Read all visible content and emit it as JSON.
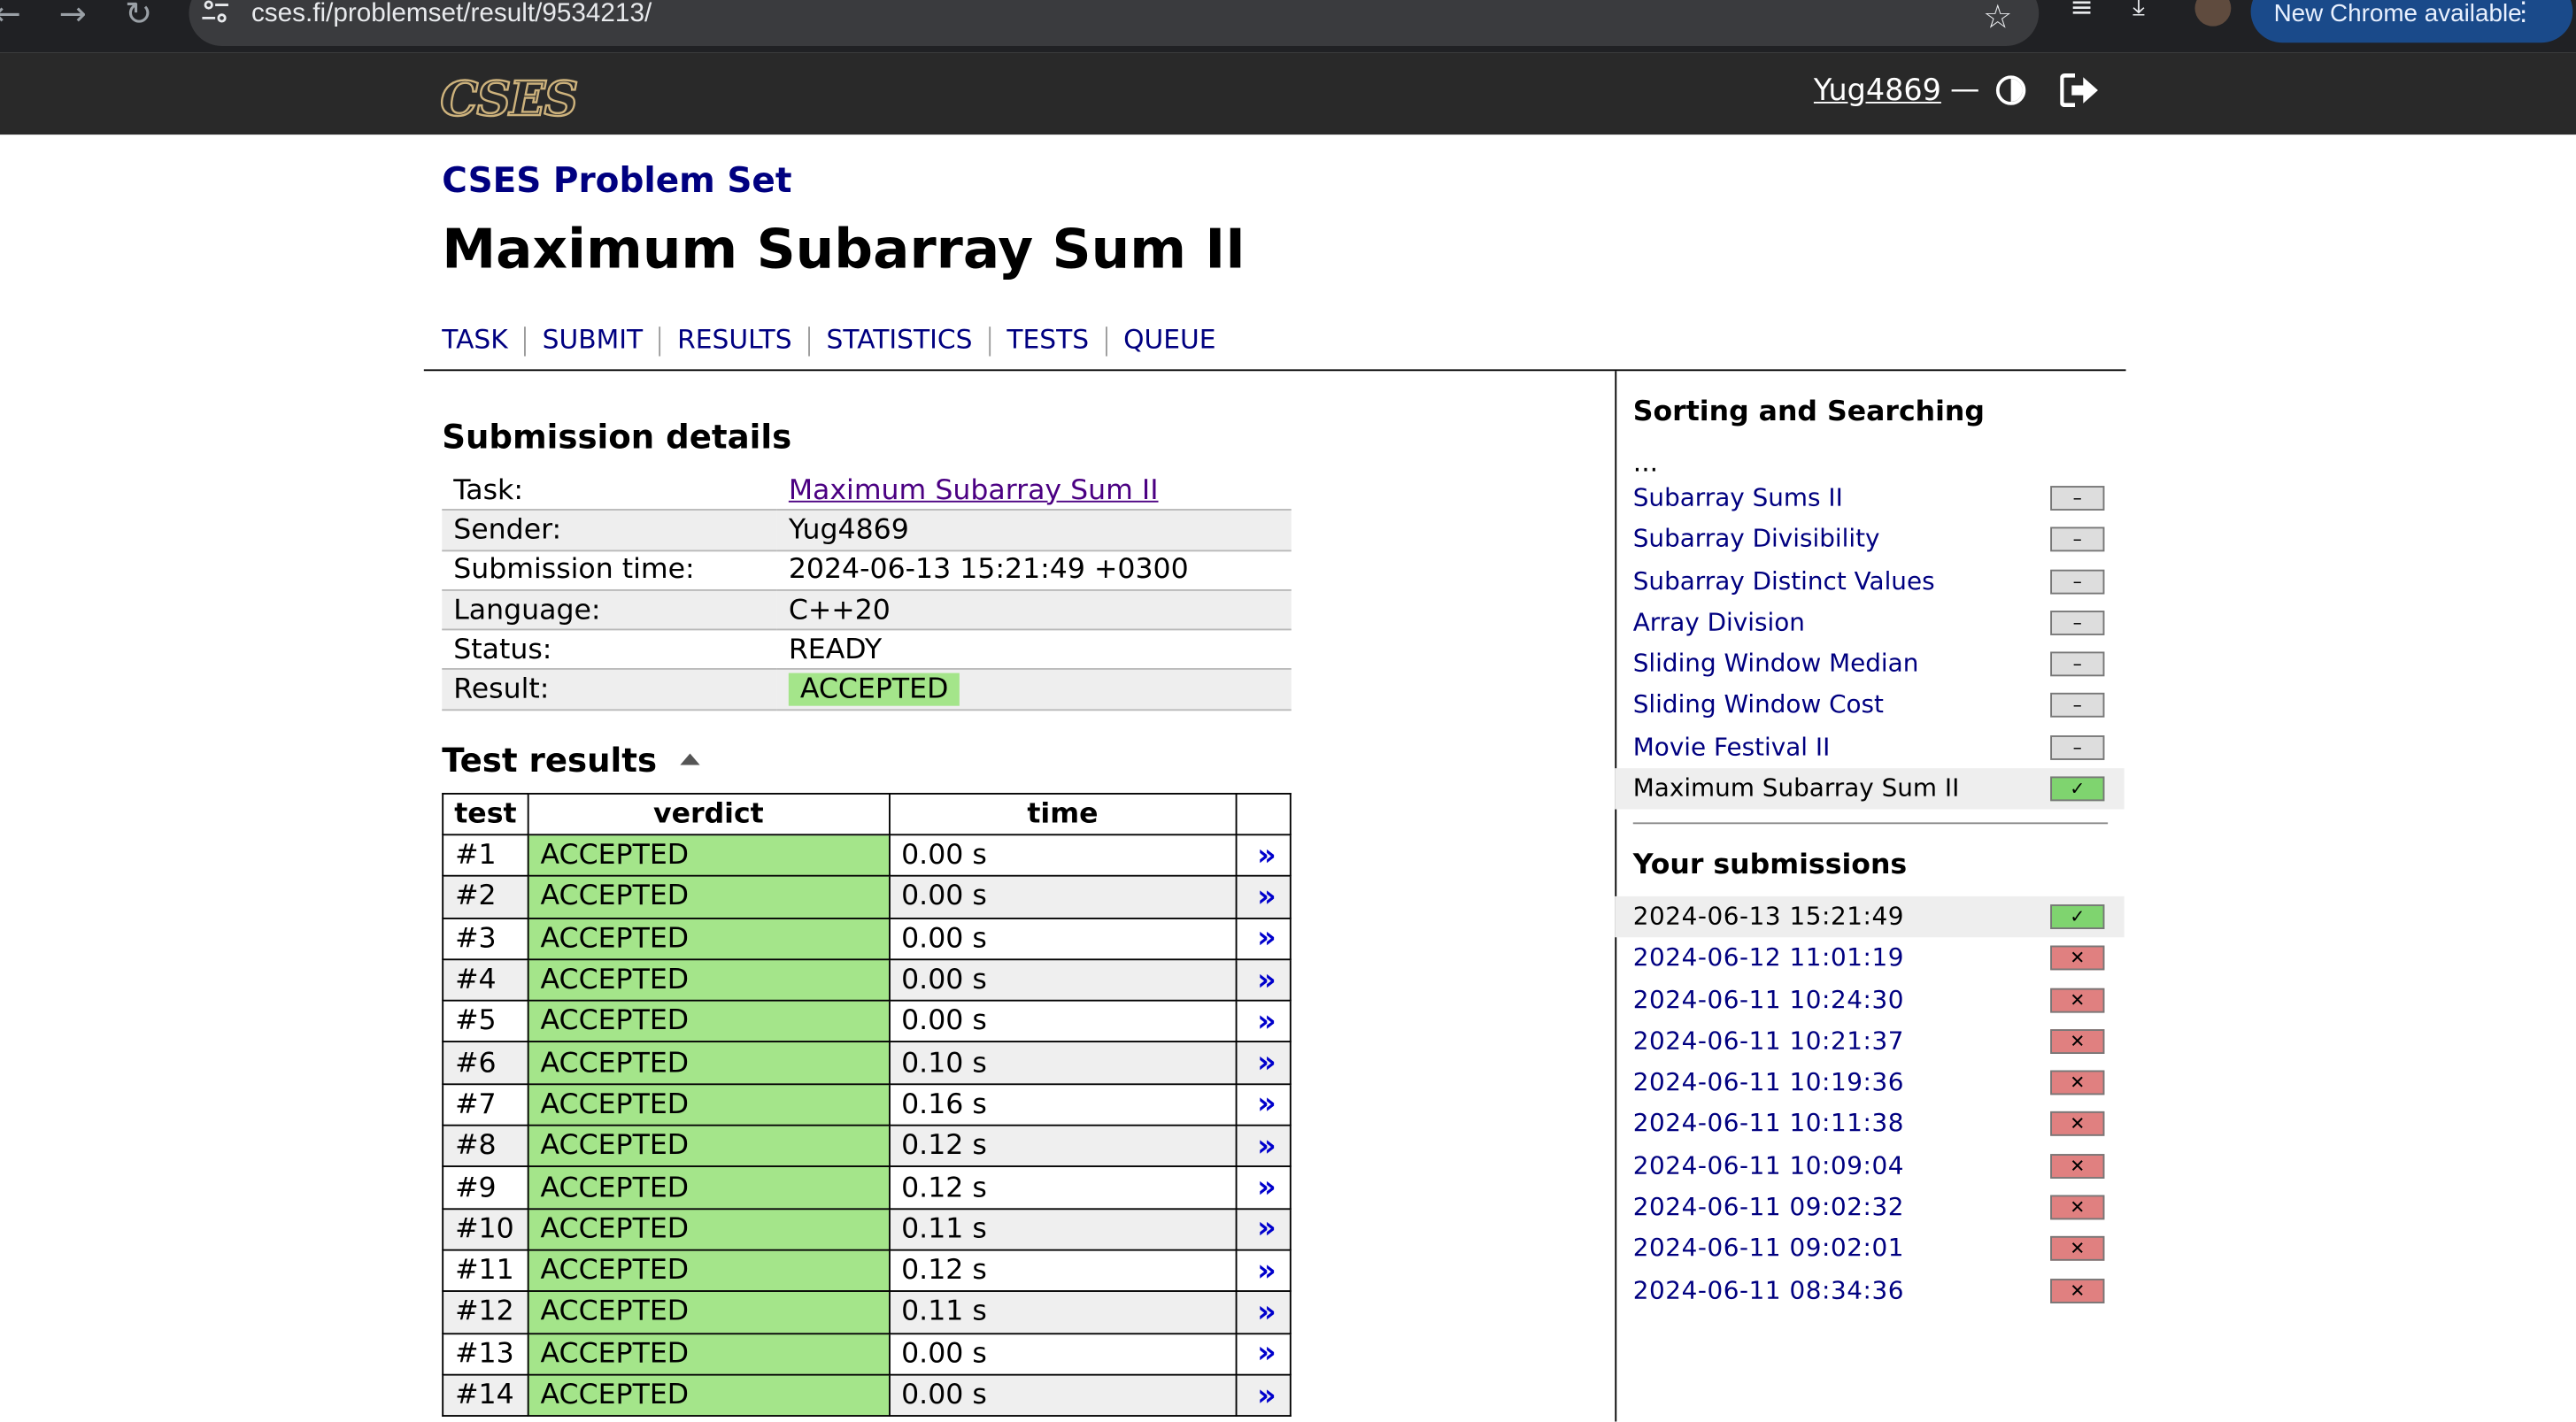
{
  "browser": {
    "url": "cses.fi/problemset/result/9534213/",
    "new_chrome": "New Chrome available"
  },
  "header": {
    "logo": "CSES",
    "username": "Yug4869",
    "dash": "—"
  },
  "page": {
    "problem_set": "CSES Problem Set",
    "title": "Maximum Subarray Sum II",
    "nav": [
      "TASK",
      "SUBMIT",
      "RESULTS",
      "STATISTICS",
      "TESTS",
      "QUEUE"
    ]
  },
  "details": {
    "heading": "Submission details",
    "rows": [
      {
        "label": "Task:",
        "value": "Maximum Subarray Sum II"
      },
      {
        "label": "Sender:",
        "value": "Yug4869"
      },
      {
        "label": "Submission time:",
        "value": "2024-06-13 15:21:49 +0300"
      },
      {
        "label": "Language:",
        "value": "C++20"
      },
      {
        "label": "Status:",
        "value": "READY"
      },
      {
        "label": "Result:",
        "value": "ACCEPTED"
      }
    ]
  },
  "tests": {
    "heading": "Test results",
    "columns": [
      "test",
      "verdict",
      "time"
    ],
    "rows": [
      {
        "test": "#1",
        "verdict": "ACCEPTED",
        "time": "0.00 s"
      },
      {
        "test": "#2",
        "verdict": "ACCEPTED",
        "time": "0.00 s"
      },
      {
        "test": "#3",
        "verdict": "ACCEPTED",
        "time": "0.00 s"
      },
      {
        "test": "#4",
        "verdict": "ACCEPTED",
        "time": "0.00 s"
      },
      {
        "test": "#5",
        "verdict": "ACCEPTED",
        "time": "0.00 s"
      },
      {
        "test": "#6",
        "verdict": "ACCEPTED",
        "time": "0.10 s"
      },
      {
        "test": "#7",
        "verdict": "ACCEPTED",
        "time": "0.16 s"
      },
      {
        "test": "#8",
        "verdict": "ACCEPTED",
        "time": "0.12 s"
      },
      {
        "test": "#9",
        "verdict": "ACCEPTED",
        "time": "0.12 s"
      },
      {
        "test": "#10",
        "verdict": "ACCEPTED",
        "time": "0.11 s"
      },
      {
        "test": "#11",
        "verdict": "ACCEPTED",
        "time": "0.12 s"
      },
      {
        "test": "#12",
        "verdict": "ACCEPTED",
        "time": "0.11 s"
      },
      {
        "test": "#13",
        "verdict": "ACCEPTED",
        "time": "0.00 s"
      },
      {
        "test": "#14",
        "verdict": "ACCEPTED",
        "time": "0.00 s"
      }
    ],
    "view_link": "»"
  },
  "sidebar": {
    "section_title": "Sorting and Searching",
    "ellipsis": "...",
    "problems": [
      {
        "name": "Subarray Sums II",
        "status": "–",
        "state": "unsolved"
      },
      {
        "name": "Subarray Divisibility",
        "status": "–",
        "state": "unsolved"
      },
      {
        "name": "Subarray Distinct Values",
        "status": "–",
        "state": "unsolved"
      },
      {
        "name": "Array Division",
        "status": "–",
        "state": "unsolved"
      },
      {
        "name": "Sliding Window Median",
        "status": "–",
        "state": "unsolved"
      },
      {
        "name": "Sliding Window Cost",
        "status": "–",
        "state": "unsolved"
      },
      {
        "name": "Movie Festival II",
        "status": "–",
        "state": "unsolved"
      },
      {
        "name": "Maximum Subarray Sum II",
        "status": "✓",
        "state": "solved"
      }
    ],
    "submissions_title": "Your submissions",
    "submissions": [
      {
        "time": "2024-06-13 15:21:49",
        "status": "✓",
        "state": "accepted"
      },
      {
        "time": "2024-06-12 11:01:19",
        "status": "✕",
        "state": "failed"
      },
      {
        "time": "2024-06-11 10:24:30",
        "status": "✕",
        "state": "failed"
      },
      {
        "time": "2024-06-11 10:21:37",
        "status": "✕",
        "state": "failed"
      },
      {
        "time": "2024-06-11 10:19:36",
        "status": "✕",
        "state": "failed"
      },
      {
        "time": "2024-06-11 10:11:38",
        "status": "✕",
        "state": "failed"
      },
      {
        "time": "2024-06-11 10:09:04",
        "status": "✕",
        "state": "failed"
      },
      {
        "time": "2024-06-11 09:02:32",
        "status": "✕",
        "state": "failed"
      },
      {
        "time": "2024-06-11 09:02:01",
        "status": "✕",
        "state": "failed"
      },
      {
        "time": "2024-06-11 08:34:36",
        "status": "✕",
        "state": "failed"
      }
    ]
  },
  "colors": {
    "link": "#000080",
    "accepted_green": "#a4e58a",
    "header_bg": "#292929",
    "fail_red": "#e08080"
  }
}
